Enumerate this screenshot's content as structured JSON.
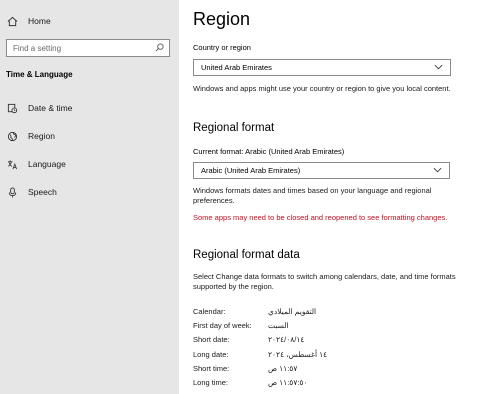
{
  "sidebar": {
    "home_label": "Home",
    "search_placeholder": "Find a setting",
    "section_title": "Time & Language",
    "items": [
      {
        "label": "Date & time"
      },
      {
        "label": "Region"
      },
      {
        "label": "Language"
      },
      {
        "label": "Speech"
      }
    ]
  },
  "main": {
    "title": "Region",
    "country_label": "Country or region",
    "country_value": "United Arab Emirates",
    "country_description": "Windows and apps might use your country or region to give you local content.",
    "regional_format_heading": "Regional format",
    "current_format_label": "Current format: Arabic (United Arab Emirates)",
    "format_value": "Arabic (United Arab Emirates)",
    "format_description": "Windows formats dates and times based on your language and regional preferences.",
    "warning": "Some apps may need to be closed and reopened to see formatting changes.",
    "data_heading": "Regional format data",
    "data_description": "Select Change data formats to switch among calendars, date, and time formats supported by the region.",
    "data_rows": [
      {
        "key": "Calendar:",
        "value": "التقويم الميلادي"
      },
      {
        "key": "First day of week:",
        "value": "السبت"
      },
      {
        "key": "Short date:",
        "value": "٢٠٢٤/٠٨/١٤"
      },
      {
        "key": "Long date:",
        "value": "١٤ أغسطس، ٢٠٢٤"
      },
      {
        "key": "Short time:",
        "value": "١١:٥٧ ص"
      },
      {
        "key": "Long time:",
        "value": "١١:٥٧:٥٠ ص"
      }
    ]
  },
  "colors": {
    "sidebar_bg": "#e6e6e6",
    "warning": "#c50f1f"
  },
  "icons": [
    "home-icon",
    "search-icon",
    "clock-icon",
    "globe-icon",
    "language-icon",
    "microphone-icon",
    "chevron-down-icon"
  ]
}
